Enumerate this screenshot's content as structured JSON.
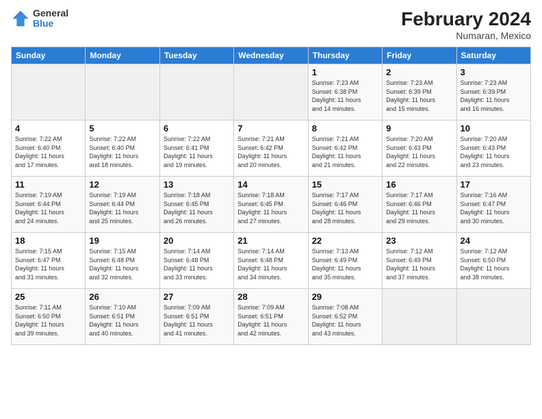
{
  "header": {
    "logo_general": "General",
    "logo_blue": "Blue",
    "month_year": "February 2024",
    "location": "Numaran, Mexico"
  },
  "days_of_week": [
    "Sunday",
    "Monday",
    "Tuesday",
    "Wednesday",
    "Thursday",
    "Friday",
    "Saturday"
  ],
  "weeks": [
    [
      {
        "day": "",
        "info": ""
      },
      {
        "day": "",
        "info": ""
      },
      {
        "day": "",
        "info": ""
      },
      {
        "day": "",
        "info": ""
      },
      {
        "day": "1",
        "info": "Sunrise: 7:23 AM\nSunset: 6:38 PM\nDaylight: 11 hours\nand 14 minutes."
      },
      {
        "day": "2",
        "info": "Sunrise: 7:23 AM\nSunset: 6:39 PM\nDaylight: 11 hours\nand 15 minutes."
      },
      {
        "day": "3",
        "info": "Sunrise: 7:23 AM\nSunset: 6:39 PM\nDaylight: 11 hours\nand 16 minutes."
      }
    ],
    [
      {
        "day": "4",
        "info": "Sunrise: 7:22 AM\nSunset: 6:40 PM\nDaylight: 11 hours\nand 17 minutes."
      },
      {
        "day": "5",
        "info": "Sunrise: 7:22 AM\nSunset: 6:40 PM\nDaylight: 11 hours\nand 18 minutes."
      },
      {
        "day": "6",
        "info": "Sunrise: 7:22 AM\nSunset: 6:41 PM\nDaylight: 11 hours\nand 19 minutes."
      },
      {
        "day": "7",
        "info": "Sunrise: 7:21 AM\nSunset: 6:42 PM\nDaylight: 11 hours\nand 20 minutes."
      },
      {
        "day": "8",
        "info": "Sunrise: 7:21 AM\nSunset: 6:42 PM\nDaylight: 11 hours\nand 21 minutes."
      },
      {
        "day": "9",
        "info": "Sunrise: 7:20 AM\nSunset: 6:43 PM\nDaylight: 11 hours\nand 22 minutes."
      },
      {
        "day": "10",
        "info": "Sunrise: 7:20 AM\nSunset: 6:43 PM\nDaylight: 11 hours\nand 23 minutes."
      }
    ],
    [
      {
        "day": "11",
        "info": "Sunrise: 7:19 AM\nSunset: 6:44 PM\nDaylight: 11 hours\nand 24 minutes."
      },
      {
        "day": "12",
        "info": "Sunrise: 7:19 AM\nSunset: 6:44 PM\nDaylight: 11 hours\nand 25 minutes."
      },
      {
        "day": "13",
        "info": "Sunrise: 7:18 AM\nSunset: 6:45 PM\nDaylight: 11 hours\nand 26 minutes."
      },
      {
        "day": "14",
        "info": "Sunrise: 7:18 AM\nSunset: 6:45 PM\nDaylight: 11 hours\nand 27 minutes."
      },
      {
        "day": "15",
        "info": "Sunrise: 7:17 AM\nSunset: 6:46 PM\nDaylight: 11 hours\nand 28 minutes."
      },
      {
        "day": "16",
        "info": "Sunrise: 7:17 AM\nSunset: 6:46 PM\nDaylight: 11 hours\nand 29 minutes."
      },
      {
        "day": "17",
        "info": "Sunrise: 7:16 AM\nSunset: 6:47 PM\nDaylight: 11 hours\nand 30 minutes."
      }
    ],
    [
      {
        "day": "18",
        "info": "Sunrise: 7:15 AM\nSunset: 6:47 PM\nDaylight: 11 hours\nand 31 minutes."
      },
      {
        "day": "19",
        "info": "Sunrise: 7:15 AM\nSunset: 6:48 PM\nDaylight: 11 hours\nand 32 minutes."
      },
      {
        "day": "20",
        "info": "Sunrise: 7:14 AM\nSunset: 6:48 PM\nDaylight: 11 hours\nand 33 minutes."
      },
      {
        "day": "21",
        "info": "Sunrise: 7:14 AM\nSunset: 6:48 PM\nDaylight: 11 hours\nand 34 minutes."
      },
      {
        "day": "22",
        "info": "Sunrise: 7:13 AM\nSunset: 6:49 PM\nDaylight: 11 hours\nand 35 minutes."
      },
      {
        "day": "23",
        "info": "Sunrise: 7:12 AM\nSunset: 6:49 PM\nDaylight: 11 hours\nand 37 minutes."
      },
      {
        "day": "24",
        "info": "Sunrise: 7:12 AM\nSunset: 6:50 PM\nDaylight: 11 hours\nand 38 minutes."
      }
    ],
    [
      {
        "day": "25",
        "info": "Sunrise: 7:11 AM\nSunset: 6:50 PM\nDaylight: 11 hours\nand 39 minutes."
      },
      {
        "day": "26",
        "info": "Sunrise: 7:10 AM\nSunset: 6:51 PM\nDaylight: 11 hours\nand 40 minutes."
      },
      {
        "day": "27",
        "info": "Sunrise: 7:09 AM\nSunset: 6:51 PM\nDaylight: 11 hours\nand 41 minutes."
      },
      {
        "day": "28",
        "info": "Sunrise: 7:09 AM\nSunset: 6:51 PM\nDaylight: 11 hours\nand 42 minutes."
      },
      {
        "day": "29",
        "info": "Sunrise: 7:08 AM\nSunset: 6:52 PM\nDaylight: 11 hours\nand 43 minutes."
      },
      {
        "day": "",
        "info": ""
      },
      {
        "day": "",
        "info": ""
      }
    ]
  ]
}
